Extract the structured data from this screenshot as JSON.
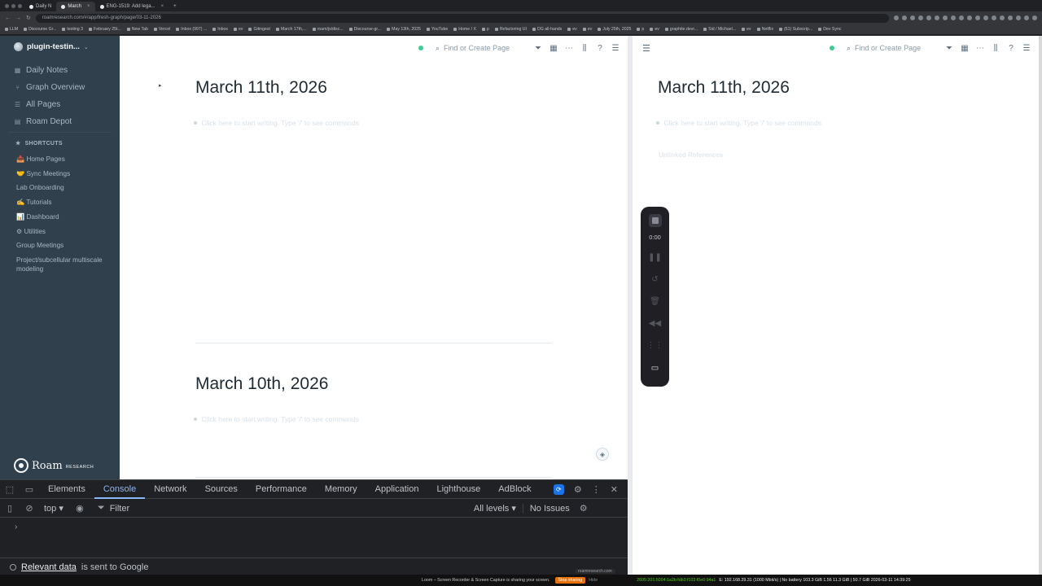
{
  "browser": {
    "tabs": [
      {
        "label": "Daily N",
        "active": false
      },
      {
        "label": "March",
        "active": true
      },
      {
        "label": "ENG-1519: Add lega...",
        "active": false
      }
    ],
    "new_tab": "+",
    "url": "roamresearch.com/#/app/fresh-graph/page/03-11-2026",
    "bookmarks": [
      "LLM",
      "Discourse Gr...",
      "testing 3",
      "February 25t...",
      "New Tab",
      "Vercel",
      "Inbox (997) ...",
      "Inbox",
      "ev",
      "Gitingest",
      "March 17th,...",
      "roam/js/disc...",
      "Discourse-gr...",
      "May 13th, 2025",
      "YouTube",
      "Home / X",
      "p",
      "Refactoring UI",
      "DG all-hands",
      "ev",
      "ev",
      "July 25th, 2025",
      "p",
      "ev",
      "graphite.devr...",
      "Sid / Michael...",
      "ev",
      "Netflix",
      "(61) Subscrip...",
      "Dev Sync"
    ],
    "all_bookmarks": "All Bookmarks"
  },
  "sidebar": {
    "graph_name": "plugin-testin...",
    "nav": [
      {
        "label": "Daily Notes",
        "icon": "calendar-icon"
      },
      {
        "label": "Graph Overview",
        "icon": "graph-icon"
      },
      {
        "label": "All Pages",
        "icon": "list-icon"
      },
      {
        "label": "Roam Depot",
        "icon": "store-icon"
      }
    ],
    "shortcuts_title": "SHORTCUTS",
    "shortcuts": [
      "📥 Home Pages",
      "🤝 Sync Meetings",
      "Lab Onboarding",
      "✍️ Tutorials",
      "📊 Dashboard",
      "⚙ Utilities",
      "Group Meetings",
      "Project/subcellular multiscale modeling"
    ],
    "logo_word": "Roam",
    "logo_sub": "RESEARCH"
  },
  "main": {
    "search_placeholder": "Find or Create Page",
    "pages": [
      {
        "title": "March 11th, 2026",
        "placeholder": "Click here to start writing. Type '/' to see commands"
      },
      {
        "title": "March 10th, 2026",
        "placeholder": "Click here to start writing. Type '/' to see commands"
      }
    ]
  },
  "right": {
    "search_placeholder": "Find or Create Page",
    "title": "March 11th, 2026",
    "placeholder": "Click here to start writing. Type '/' to see commands.",
    "unlinked": "Unlinked References"
  },
  "loom": {
    "time": "0:00"
  },
  "devtools": {
    "tabs": [
      "Elements",
      "Console",
      "Network",
      "Sources",
      "Performance",
      "Memory",
      "Application",
      "Lighthouse",
      "AdBlock"
    ],
    "active_tab": "Console",
    "context": "top",
    "filter_placeholder": "Filter",
    "levels": "All levels",
    "issues": "No Issues",
    "prompt": "›",
    "notice_link": "Relevant data",
    "notice_text": "is sent to Google"
  },
  "os": {
    "loom_msg": "Loom – Screen Recorder & Screen Capture is sharing your screen.",
    "stop_sharing": "Stop sharing",
    "hide": "Hide",
    "site_note": "roamresearch.com",
    "ip": "2605:201:5004:1a2b:fdb3:f103:f0e0:94a1",
    "sys": "E: 192.168.29.31 (1000 Mbit/s) | No battery 103.3 GiB 1.56 11.3 GiB | 50.7 GiB 2026-03-11 14:39:25"
  },
  "colors": {
    "sidebar_bg": "#30404d",
    "accent_blue": "#8ab4f8",
    "status_green": "#3dcc91"
  }
}
